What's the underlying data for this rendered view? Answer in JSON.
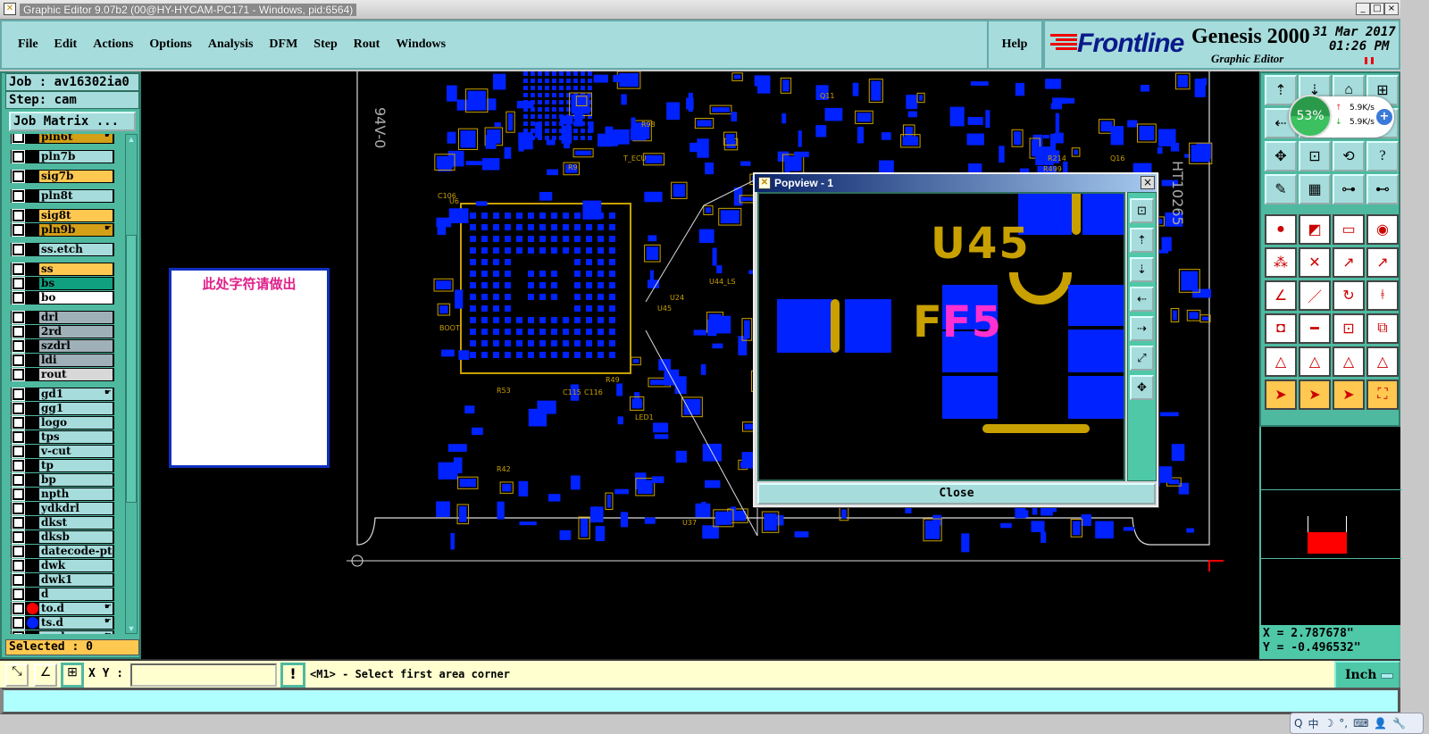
{
  "window": {
    "title": "Graphic Editor 9.07b2 (00@HY-HYCAM-PC171 - Windows, pid:6564)",
    "minimize": "_",
    "maximize": "□",
    "close": "×"
  },
  "menu": {
    "items": [
      "File",
      "Edit",
      "Actions",
      "Options",
      "Analysis",
      "DFM",
      "Step",
      "Rout",
      "Windows"
    ],
    "help": "Help"
  },
  "logo": {
    "brand": "Frontline",
    "product": "Genesis 2000",
    "subtitle": "Graphic Editor",
    "date": "31 Mar 2017",
    "time": "01:26 PM"
  },
  "job": {
    "job_label": "Job : av16302ia0",
    "step_label": "Step: cam",
    "matrix_button": "Job Matrix ..."
  },
  "layers": [
    {
      "name": "pln6t",
      "color": "#d4a017",
      "hand": true
    },
    {
      "name": "pln7b",
      "color": "#a6dcdc"
    },
    {
      "name": "sig7b",
      "color": "#ffc850"
    },
    {
      "name": "pln8t",
      "color": "#a6dcdc"
    },
    {
      "name": "sig8t",
      "color": "#ffc850"
    },
    {
      "name": "pln9b",
      "color": "#d4a017",
      "hand": true
    },
    {
      "name": "ss.etch",
      "color": "#a6dcdc"
    },
    {
      "name": "ss",
      "color": "#ffc850"
    },
    {
      "name": "bs",
      "color": "#10a080"
    },
    {
      "name": "bo",
      "color": "#ffffff"
    },
    {
      "name": "drl",
      "color": "#a0b0b8"
    },
    {
      "name": "2rd",
      "color": "#a0b0b8"
    },
    {
      "name": "szdrl",
      "color": "#a0b0b8"
    },
    {
      "name": "ldi",
      "color": "#a0b0b8"
    },
    {
      "name": "rout",
      "color": "#d8d8d8"
    },
    {
      "name": "gd1",
      "color": "#a6dcdc",
      "hand": true
    },
    {
      "name": "gg1",
      "color": "#a6dcdc"
    },
    {
      "name": "logo",
      "color": "#a6dcdc"
    },
    {
      "name": "tps",
      "color": "#a6dcdc"
    },
    {
      "name": "v-cut",
      "color": "#a6dcdc"
    },
    {
      "name": "tp",
      "color": "#a6dcdc"
    },
    {
      "name": "bp",
      "color": "#a6dcdc"
    },
    {
      "name": "npth",
      "color": "#a6dcdc"
    },
    {
      "name": "ydkdrl",
      "color": "#a6dcdc"
    },
    {
      "name": "dkst",
      "color": "#a6dcdc"
    },
    {
      "name": "dksb",
      "color": "#a6dcdc"
    },
    {
      "name": "datecode-ptc",
      "color": "#a6dcdc"
    },
    {
      "name": "dwk",
      "color": "#a6dcdc"
    },
    {
      "name": "dwk1",
      "color": "#a6dcdc"
    },
    {
      "name": "d",
      "color": "#a6dcdc"
    },
    {
      "name": "to.d",
      "color": "#a6dcdc",
      "hand": true,
      "dot": "#ff0000"
    },
    {
      "name": "ts.d",
      "color": "#a6dcdc",
      "hand": true,
      "dot": "#0022ff"
    },
    {
      "name": "cs.d",
      "color": "#a6dcdc",
      "hand": true
    }
  ],
  "selected": "Selected : 0",
  "canvas": {
    "note": "此处字符请做出",
    "labels": [
      "U45",
      "U44_LS",
      "U24",
      "BOOT",
      "LED1",
      "R42",
      "R53",
      "C115",
      "C116",
      "R49",
      "U37",
      "HT10265",
      "94V-0",
      "R9",
      "R98",
      "C106",
      "U6",
      "T_ECU",
      "Q11",
      "R499",
      "R214",
      "Q16"
    ]
  },
  "popview": {
    "title": "Popview - 1",
    "close_label": "Close",
    "labels": {
      "u45": "U45",
      "f5": "F5"
    }
  },
  "network_widget": {
    "percent": "53%",
    "up": "5.9K/s",
    "down": "5.9K/s"
  },
  "coords": {
    "x": "X = 2.787678\"",
    "y": "Y = -0.496532\""
  },
  "bottom": {
    "xy_label": "X Y :",
    "xy_value": "",
    "message": "<M1> - Select first area corner",
    "units": "Inch"
  },
  "tray": {
    "items": [
      "Q",
      "中",
      "☽",
      "°,",
      "⌨",
      "👤",
      "🔧"
    ]
  },
  "colors": {
    "panel": "#4fb9a0",
    "menu": "#a6dcdc",
    "pad": "#0022ff",
    "silk": "#c8a000",
    "message_bg": "#ffffd0"
  }
}
